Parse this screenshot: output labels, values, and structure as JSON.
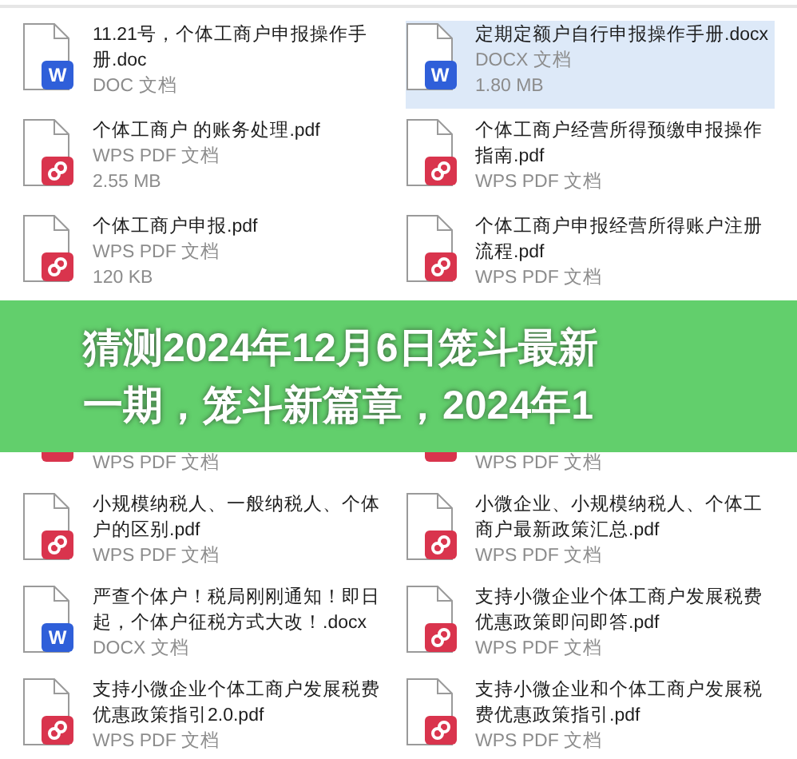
{
  "top_files": [
    {
      "name": "11.21号，个体工商户申报操作手册.doc",
      "type": "DOC 文档",
      "kind": "word",
      "badge": "W",
      "selected": false
    },
    {
      "name": "定期定额户自行申报操作手册.docx",
      "type": "DOCX 文档",
      "size": "1.80 MB",
      "kind": "word",
      "badge": "W",
      "selected": true
    },
    {
      "name": "个体工商户 的账务处理.pdf",
      "type": "WPS PDF 文档",
      "size": "2.55 MB",
      "kind": "pdf",
      "selected": false
    },
    {
      "name": "个体工商户经营所得预缴申报操作指南.pdf",
      "type": "WPS PDF 文档",
      "kind": "pdf",
      "selected": false
    },
    {
      "name": "个体工商户申报.pdf",
      "type": "WPS PDF 文档",
      "size": "120 KB",
      "kind": "pdf",
      "selected": false
    },
    {
      "name": "个体工商户申报经营所得账户注册流程.pdf",
      "type": "WPS PDF 文档",
      "kind": "pdf",
      "selected": false
    }
  ],
  "banner": {
    "lines": [
      "猜测2024年12月6日笼斗最新",
      "一期，笼斗新篇章，2024年1"
    ]
  },
  "partial_files": [
    {
      "type": "WPS PDF 文档",
      "kind": "pdf"
    },
    {
      "type": "WPS PDF 文档",
      "kind": "pdf"
    }
  ],
  "bottom_files": [
    {
      "name": "小规模纳税人、一般纳税人、个体户的区别.pdf",
      "type": "WPS PDF 文档",
      "kind": "pdf",
      "selected": false
    },
    {
      "name": "小微企业、小规模纳税人、个体工商户最新政策汇总.pdf",
      "type": "WPS PDF 文档",
      "kind": "pdf",
      "selected": false
    },
    {
      "name": "严查个体户！税局刚刚通知！即日起，个体户征税方式大改！.docx",
      "type": "DOCX 文档",
      "kind": "word",
      "badge": "W",
      "selected": false
    },
    {
      "name": "支持小微企业个体工商户发展税费优惠政策即问即答.pdf",
      "type": "WPS PDF 文档",
      "kind": "pdf",
      "selected": false
    },
    {
      "name": "支持小微企业个体工商户发展税费优惠政策指引2.0.pdf",
      "type": "WPS PDF 文档",
      "kind": "pdf",
      "selected": false
    },
    {
      "name": "支持小微企业和个体工商户发展税费优惠政策指引.pdf",
      "type": "WPS PDF 文档",
      "kind": "pdf",
      "selected": false
    }
  ]
}
